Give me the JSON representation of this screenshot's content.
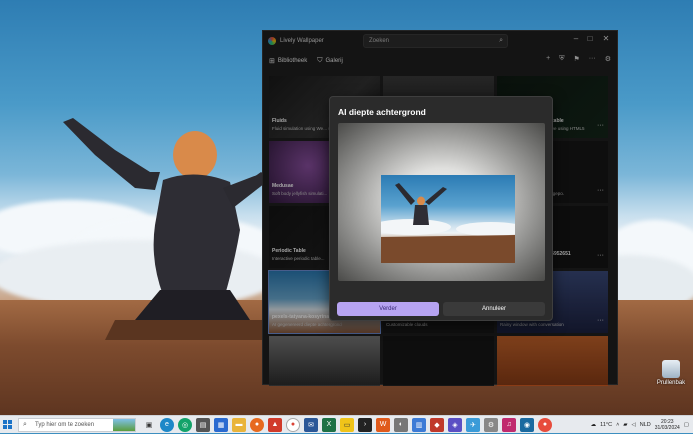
{
  "window": {
    "title": "Lively Wallpaper",
    "search_placeholder": "Zoeken"
  },
  "tabs": [
    {
      "label": "Bibliotheek"
    },
    {
      "label": "Galerij"
    }
  ],
  "tiles": [
    {
      "title": "Fluids",
      "sub": "Fluid simulation using We... system audio & camer..."
    },
    {
      "title": "Medusae",
      "sub": "Soft body jellyfish simulati..."
    },
    {
      "title": "Periodic Table",
      "sub": "Interactive periodic table..."
    },
    {
      "title": "pexels-tatyana-kosyrina-...",
      "sub": "AI gegenereerd diepte achtergrond"
    },
    {
      "title": "...zable",
      "sub": "...ive using HTML5"
    },
    {
      "title": "",
      "sub": "...gepo."
    },
    {
      "title": "...5952651",
      "sub": ""
    },
    {
      "title": "",
      "sub": "Customizable clouds"
    },
    {
      "title": "",
      "sub": "Rainy window with conversation"
    }
  ],
  "dialog": {
    "title": "AI diepte achtergrond",
    "primary": "Verder",
    "secondary": "Annuleer"
  },
  "desktop": {
    "recycle_label": "Prullenbak"
  },
  "taskbar": {
    "search_placeholder": "Typ hier om te zoeken",
    "weather": "11°C",
    "lang": "NLD",
    "time": "20:23",
    "date": "31/03/2024"
  }
}
